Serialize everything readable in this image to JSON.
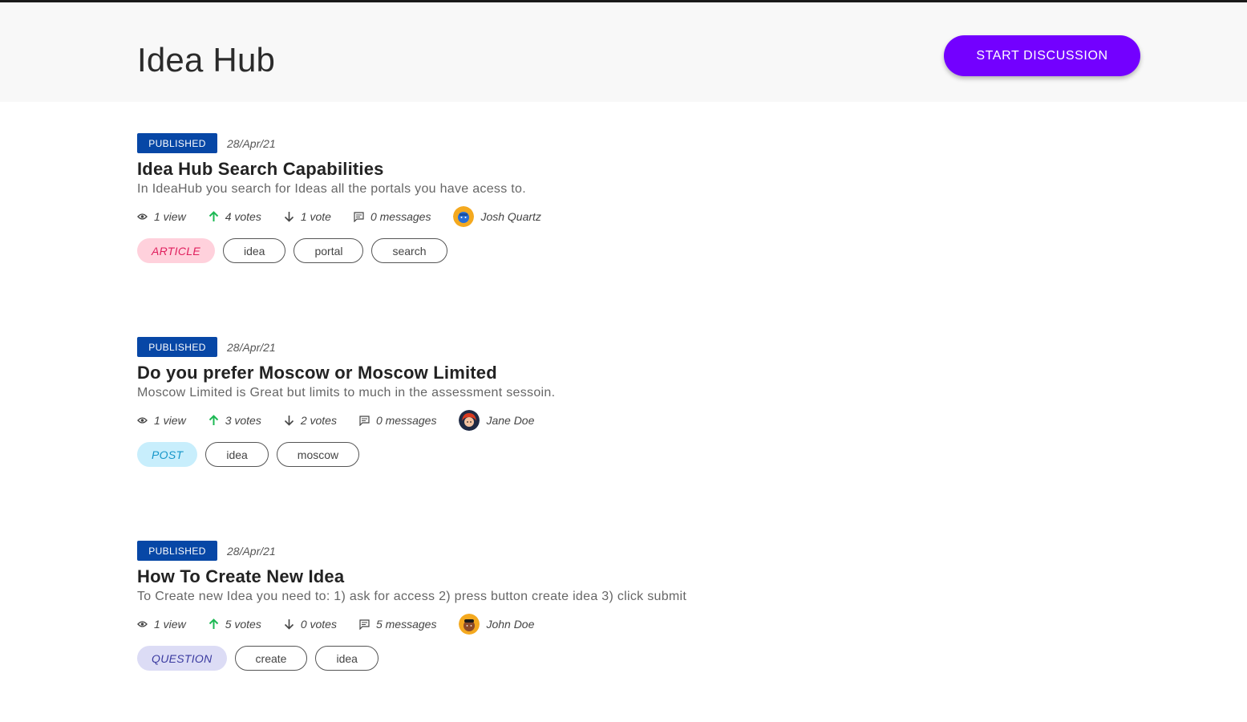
{
  "header": {
    "title": "Idea Hub",
    "start_button_label": "START DISCUSSION"
  },
  "colors": {
    "accent": "#7300ff",
    "published_badge": "#0747a6",
    "upvote": "#1db954",
    "article_bg": "#ffd1dc",
    "article_fg": "#e0205e",
    "post_bg": "#c8eefc",
    "post_fg": "#1596c9",
    "question_bg": "#dcdcf5",
    "question_fg": "#3a3aa0"
  },
  "posts": [
    {
      "status": "PUBLISHED",
      "date": "28/Apr/21",
      "title": "Idea Hub Search Capabilities",
      "description": "In IdeaHub you search for Ideas all the portals you have acess to.",
      "views": "1 view",
      "upvotes": "4 votes",
      "downvotes": "1 vote",
      "messages": "0 messages",
      "author": "Josh Quartz",
      "avatar_icon": "avatar-blue-face",
      "type": "ARTICLE",
      "tags": [
        "idea",
        "portal",
        "search"
      ]
    },
    {
      "status": "PUBLISHED",
      "date": "28/Apr/21",
      "title": "Do you prefer Moscow or Moscow Limited",
      "description": "Moscow Limited is Great but limits to much in the assessment sessoin.",
      "views": "1 view",
      "upvotes": "3 votes",
      "downvotes": "2 votes",
      "messages": "0 messages",
      "author": "Jane Doe",
      "avatar_icon": "avatar-red-hair",
      "type": "POST",
      "tags": [
        "idea",
        "moscow"
      ]
    },
    {
      "status": "PUBLISHED",
      "date": "28/Apr/21",
      "title": "How To Create New Idea",
      "description": "To Create new Idea you need to: 1) ask for access 2) press button create idea 3) click submit",
      "views": "1 view",
      "upvotes": "5 votes",
      "downvotes": "0 votes",
      "messages": "5 messages",
      "author": "John Doe",
      "avatar_icon": "avatar-dark-hair",
      "type": "QUESTION",
      "tags": [
        "create",
        "idea"
      ]
    }
  ]
}
